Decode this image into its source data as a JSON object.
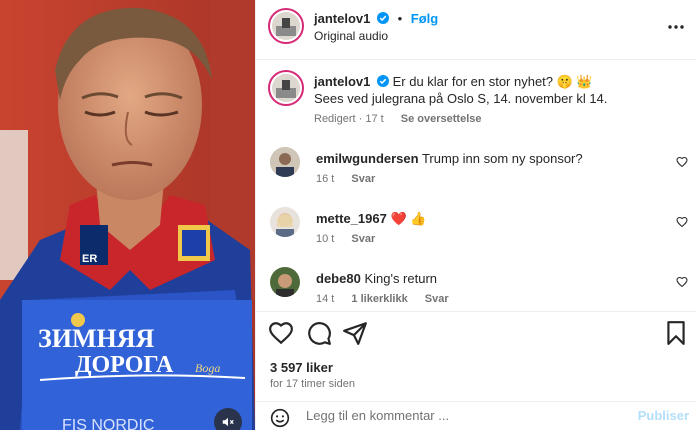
{
  "header": {
    "username": "jantelov1",
    "dot": "•",
    "follow_label": "Følg",
    "audio": "Original audio",
    "more_icon": "more-horizontal-icon"
  },
  "caption": {
    "username": "jantelov1",
    "text_line1": "Er du klar for en stor nyhet? 🤫 👑",
    "text_line2": "Sees ved julegrana på Oslo S, 14. november kl 14.",
    "edited": "Redigert · 17 t",
    "translate": "Se oversettelse"
  },
  "comments": [
    {
      "username": "emilwgundersen",
      "text": "Trump inn som ny sponsor?",
      "time": "16 t",
      "reply": "Svar",
      "likes": ""
    },
    {
      "username": "mette_1967",
      "text": "❤️ 👍",
      "time": "10 t",
      "reply": "Svar",
      "likes": ""
    },
    {
      "username": "debe80",
      "text": "King's return",
      "time": "14 t",
      "reply": "Svar",
      "likes": "1 likerklikk"
    }
  ],
  "actions": {
    "likes": "3 597 liker",
    "time_ago": "for 17 timer siden",
    "comment_placeholder": "Legg til en kommentar ...",
    "post_label": "Publiser"
  },
  "media": {
    "bib_line1": "ЗИМНЯЯ",
    "bib_line2": "ДОРОГА",
    "bib_small": "Boga",
    "bib_bottom": "FIS NORDIC",
    "bib_partial": "ER"
  },
  "colors": {
    "accent": "#0095f6",
    "post_disabled": "#b2dffc",
    "verified": "#0095f6",
    "heart_red": "#ed4956"
  }
}
